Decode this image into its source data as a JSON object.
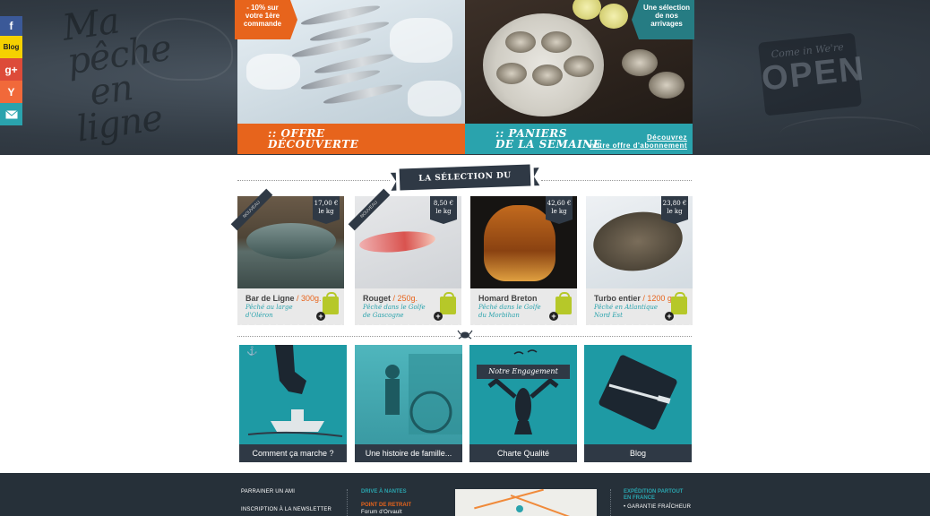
{
  "social": {
    "blog": "Blog"
  },
  "chalk": {
    "logo_line1": "Ma",
    "logo_line2": "pêche",
    "logo_line3": "en",
    "logo_line4": "ligne",
    "open_small": "Come in We're",
    "open_big": "OPEN"
  },
  "banners": {
    "left": {
      "tag_line1": "- 10% sur",
      "tag_line2": "votre 1ère",
      "tag_line3": "commande",
      "title_line1": ":: OFFRE",
      "title_line2": "DÉCOUVERTE"
    },
    "right": {
      "tag_line1": "Une sélection",
      "tag_line2": "de nos",
      "tag_line3": "arrivages",
      "title_line1": ":: PANIERS",
      "title_line2": "DE LA SEMAINE",
      "cta_line1": "Découvrez",
      "cta_line2": "notre offre d'abonnement"
    }
  },
  "section_title": "LA SÉLECTION DU PATRON",
  "products": [
    {
      "price": "17,00 €",
      "unit": "le kg",
      "badge": "NOUVEAU",
      "name": "Bar de Ligne",
      "weight": " / 300g.",
      "origin": "Pêché au large d'Oléron"
    },
    {
      "price": "8,50 €",
      "unit": "le kg",
      "badge": "NOUVEAU",
      "name": "Rouget",
      "weight": " / 250g.",
      "origin": "Pêché dans le Golfe de Gascogne"
    },
    {
      "price": "42,60 €",
      "unit": "le kg",
      "badge": "",
      "name": "Homard Breton",
      "weight": "",
      "origin": "Pêché dans le Golfe du Morbihan"
    },
    {
      "price": "23,80 €",
      "unit": "le kg",
      "badge": "",
      "name": "Turbo entier",
      "weight": " / 1200 g.",
      "origin": "Pêché en Atlantique Nord Est"
    }
  ],
  "tiles": [
    {
      "caption": "Comment ça marche ?"
    },
    {
      "caption": "Une histoire de famille..."
    },
    {
      "caption": "Charte Qualité",
      "banner": "Notre Engagement"
    },
    {
      "caption": "Blog"
    }
  ],
  "footer": {
    "link1": "PARRAINER UN AMI",
    "link2": "INSCRIPTION À LA NEWSLETTER",
    "drive_head": "DRIVE À NANTES",
    "pickup_head": "POINT DE RETRAIT",
    "pickup_place": "Forum d'Orvault",
    "shipping_head_line1": "EXPÉDITION PARTOUT",
    "shipping_head_line2": "EN FRANCE",
    "guarantee": "• GARANTIE FRAÎCHEUR"
  },
  "colors": {
    "orange": "#e7641c",
    "teal": "#2aa3ad",
    "navy": "#2f3945"
  }
}
